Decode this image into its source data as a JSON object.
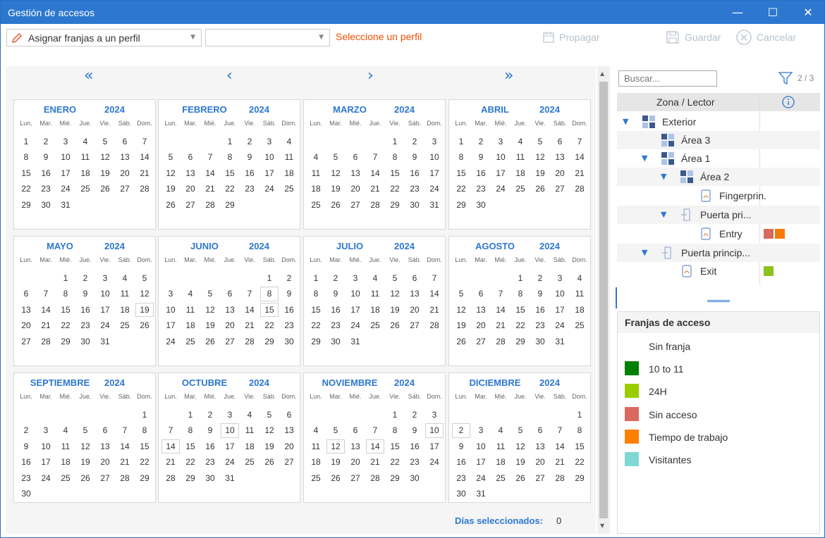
{
  "window": {
    "title": "Gestión de accesos",
    "minimize": "—",
    "maximize": "☐",
    "close": "✕"
  },
  "toolbar": {
    "mode_value": "Asignar franjas a un perfil",
    "profile_value": "",
    "hint": "Seleccione un perfil",
    "propagar_label": "Propagar",
    "guardar_label": "Guardar",
    "cancelar_label": "Cancelar"
  },
  "calendar_nav": {
    "first": "«",
    "prev": "‹",
    "next": "›",
    "last": "»"
  },
  "weekday_headers": [
    "Lun.",
    "Mar.",
    "Mié.",
    "Jue.",
    "Vie.",
    "Sáb.",
    "Dom."
  ],
  "months": [
    {
      "name": "ENERO",
      "year": "2024",
      "offset": 0,
      "days": 31
    },
    {
      "name": "FEBRERO",
      "year": "2024",
      "offset": 3,
      "days": 29
    },
    {
      "name": "MARZO",
      "year": "2024",
      "offset": 4,
      "days": 31
    },
    {
      "name": "ABRIL",
      "year": "2024",
      "offset": 0,
      "days": 30
    },
    {
      "name": "MAYO",
      "year": "2024",
      "offset": 2,
      "days": 31
    },
    {
      "name": "JUNIO",
      "year": "2024",
      "offset": 5,
      "days": 30
    },
    {
      "name": "JULIO",
      "year": "2024",
      "offset": 0,
      "days": 31
    },
    {
      "name": "AGOSTO",
      "year": "2024",
      "offset": 3,
      "days": 31
    },
    {
      "name": "SEPTIEMBRE",
      "year": "2024",
      "offset": 6,
      "days": 30
    },
    {
      "name": "OCTUBRE",
      "year": "2024",
      "offset": 1,
      "days": 31
    },
    {
      "name": "NOVIEMBRE",
      "year": "2024",
      "offset": 4,
      "days": 30
    },
    {
      "name": "DICIEMBRE",
      "year": "2024",
      "offset": 6,
      "days": 31
    }
  ],
  "highlighted_days": {
    "4": [
      19
    ],
    "5": [
      8,
      15
    ],
    "6": [],
    "7": [],
    "9": [
      10,
      14
    ],
    "10": [
      10,
      12,
      14
    ],
    "11": [
      2
    ]
  },
  "status": {
    "selected_label": "Días seleccionados:",
    "selected_count": "0"
  },
  "search": {
    "placeholder": "Buscar..."
  },
  "filter": {
    "count": "2 / 3"
  },
  "tree": {
    "header": "Zona / Lector",
    "rows": [
      {
        "label": "Exterior",
        "level": 0,
        "expanded": true,
        "icon": "zone-icon",
        "swatches": []
      },
      {
        "label": "Área 3",
        "level": 1,
        "expanded": null,
        "icon": "zone-icon",
        "swatches": []
      },
      {
        "label": "Área 1",
        "level": 1,
        "expanded": true,
        "icon": "zone-icon",
        "swatches": []
      },
      {
        "label": "Área 2",
        "level": 2,
        "expanded": true,
        "icon": "zone-icon",
        "swatches": []
      },
      {
        "label": "Fingerprin.",
        "level": 3,
        "expanded": null,
        "icon": "reader-icon",
        "swatches": []
      },
      {
        "label": "Puerta pri...",
        "level": 2,
        "expanded": true,
        "icon": "door-icon",
        "swatches": []
      },
      {
        "label": "Entry",
        "level": 3,
        "expanded": null,
        "icon": "reader-icon",
        "swatches": [
          "#d9695f",
          "#f57c00"
        ]
      },
      {
        "label": "Puerta princip...",
        "level": 1,
        "expanded": true,
        "icon": "door-icon",
        "swatches": []
      },
      {
        "label": "Exit",
        "level": 2,
        "expanded": null,
        "icon": "reader-icon",
        "swatches": [
          "#8dc21f"
        ]
      }
    ]
  },
  "legend": {
    "title": "Franjas de acceso",
    "items": [
      {
        "label": "Sin franja",
        "color": ""
      },
      {
        "label": "10 to 11",
        "color": "#008000"
      },
      {
        "label": "24H",
        "color": "#9acd00"
      },
      {
        "label": "Sin acceso",
        "color": "#d9695f"
      },
      {
        "label": "Tiempo de trabajo",
        "color": "#ff7f00"
      },
      {
        "label": "Visitantes",
        "color": "#7fd8d4"
      }
    ]
  },
  "colors": {
    "accent": "#2d77d0",
    "hint": "#f04e00",
    "disabled": "#b8c2cc"
  }
}
